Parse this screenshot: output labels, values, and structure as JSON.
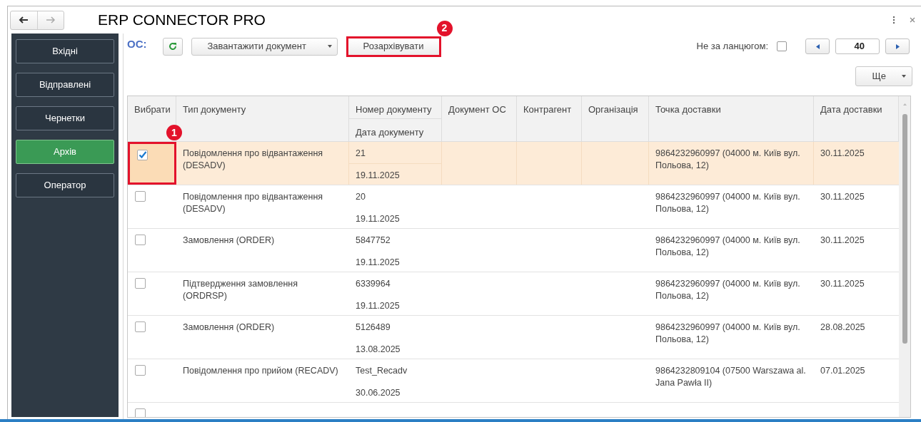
{
  "window": {
    "title": "ERP CONNECTOR PRO"
  },
  "sidebar": {
    "items": [
      {
        "label": "Вхідні",
        "selected": false
      },
      {
        "label": "Відправлені",
        "selected": false
      },
      {
        "label": "Чернетки",
        "selected": false
      },
      {
        "label": "Архів",
        "selected": true
      },
      {
        "label": "Оператор",
        "selected": false
      }
    ]
  },
  "toolbar": {
    "section_label": "ОС:",
    "load_button": "Завантажити документ",
    "unarchive_button": {
      "label": "Розархівувати",
      "callout": "2"
    },
    "chain_filter": {
      "label": "Не за ланцюгом:",
      "checked": false
    },
    "page_size": "40",
    "more_button": "Ще"
  },
  "table": {
    "columns": [
      "Вибрати",
      "Тип документу",
      "Номер документу",
      "Дата документу",
      "Документ ОС",
      "Контрагент",
      "Організація",
      "Точка доставки",
      "Дата доставки"
    ],
    "rows": [
      {
        "checked": true,
        "selected": true,
        "callout": "1",
        "type": "Повідомлення про відвантаження (DESADV)",
        "number": "21",
        "date": "19.11.2025",
        "delivery_point": "9864232960997 (04000 м. Київ вул. Польова, 12)",
        "delivery_date": "30.11.2025"
      },
      {
        "checked": false,
        "selected": false,
        "type": "Повідомлення про відвантаження (DESADV)",
        "number": "20",
        "date": "19.11.2025",
        "delivery_point": "9864232960997 (04000 м. Київ вул. Польова, 12)",
        "delivery_date": "30.11.2025"
      },
      {
        "checked": false,
        "selected": false,
        "type": "Замовлення (ORDER)",
        "number": "5847752",
        "date": "19.11.2025",
        "delivery_point": "9864232960997 (04000 м. Київ вул. Польова, 12)",
        "delivery_date": "30.11.2025"
      },
      {
        "checked": false,
        "selected": false,
        "type": "Підтвердження замовлення (ORDRSP)",
        "number": "6339964",
        "date": "19.11.2025",
        "delivery_point": "9864232960997 (04000 м. Київ вул. Польова, 12)",
        "delivery_date": "30.11.2025"
      },
      {
        "checked": false,
        "selected": false,
        "type": "Замовлення (ORDER)",
        "number": "5126489",
        "date": "13.08.2025",
        "delivery_point": "9864232960997 (04000 м. Київ вул. Польова, 12)",
        "delivery_date": "28.08.2025"
      },
      {
        "checked": false,
        "selected": false,
        "type": "Повідомлення про прийом (RECADV)",
        "number": "Test_Recadv",
        "date": "30.06.2025",
        "delivery_point": "9864232809104 (07500 Warszawa al. Jana Pawła II)",
        "delivery_date": "07.01.2025"
      },
      {
        "checked": false,
        "selected": false
      }
    ]
  }
}
